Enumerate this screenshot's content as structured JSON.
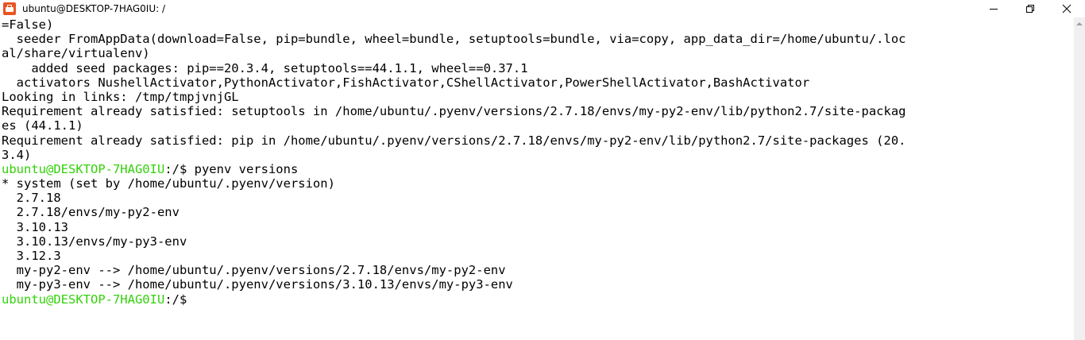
{
  "window": {
    "title": "ubuntu@DESKTOP-7HAG0IU: /",
    "icon": "ubuntu-terminal-icon"
  },
  "controls": {
    "minimize": "minimize-icon",
    "restore": "restore-icon",
    "close": "close-icon"
  },
  "colors": {
    "prompt_user": "#32d20a",
    "background": "#ffffff",
    "text": "#000000"
  },
  "terminal": {
    "lines": [
      {
        "text": "=False)"
      },
      {
        "text": "  seeder FromAppData(download=False, pip=bundle, wheel=bundle, setuptools=bundle, via=copy, app_data_dir=/home/ubuntu/.loc"
      },
      {
        "text": "al/share/virtualenv)"
      },
      {
        "text": "    added seed packages: pip==20.3.4, setuptools==44.1.1, wheel==0.37.1"
      },
      {
        "text": "  activators NushellActivator,PythonActivator,FishActivator,CShellActivator,PowerShellActivator,BashActivator"
      },
      {
        "text": "Looking in links: /tmp/tmpjvnjGL"
      },
      {
        "text": "Requirement already satisfied: setuptools in /home/ubuntu/.pyenv/versions/2.7.18/envs/my-py2-env/lib/python2.7/site-packag"
      },
      {
        "text": "es (44.1.1)"
      },
      {
        "text": "Requirement already satisfied: pip in /home/ubuntu/.pyenv/versions/2.7.18/envs/my-py2-env/lib/python2.7/site-packages (20."
      },
      {
        "text": "3.4)"
      },
      {
        "prompt": {
          "user": "ubuntu@DESKTOP-7HAG0IU",
          "path": ":/$ "
        },
        "command": "pyenv versions"
      },
      {
        "text": "* system (set by /home/ubuntu/.pyenv/version)"
      },
      {
        "text": "  2.7.18"
      },
      {
        "text": "  2.7.18/envs/my-py2-env"
      },
      {
        "text": "  3.10.13"
      },
      {
        "text": "  3.10.13/envs/my-py3-env"
      },
      {
        "text": "  3.12.3"
      },
      {
        "text": "  my-py2-env --> /home/ubuntu/.pyenv/versions/2.7.18/envs/my-py2-env"
      },
      {
        "text": "  my-py3-env --> /home/ubuntu/.pyenv/versions/3.10.13/envs/my-py3-env"
      },
      {
        "prompt": {
          "user": "ubuntu@DESKTOP-7HAG0IU",
          "path": ":/$"
        },
        "command": ""
      }
    ]
  }
}
